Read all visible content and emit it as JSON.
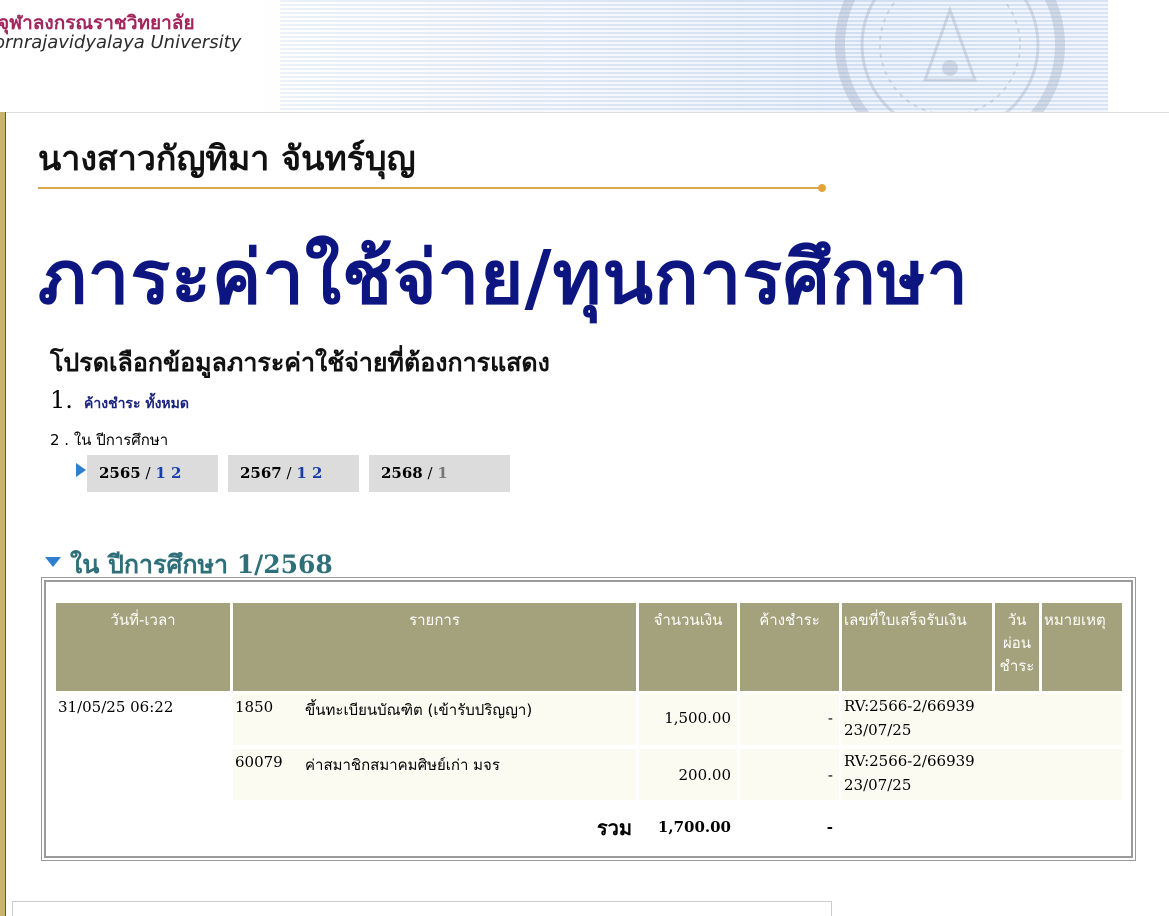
{
  "header": {
    "university_th": "จุฬาลงกรณราชวิทยาลัย",
    "university_en": "ornrajavidyalaya University"
  },
  "student_name": "นางสาวกัญทิมา จันทร์บุญ",
  "page_heading": "ภาระค่าใช้จ่าย/ทุนการศึกษา",
  "prompt": "โปรดเลือกข้อมูลภาระค่าใช้จ่ายที่ต้องการแสดง",
  "options": {
    "opt1_num": "1.",
    "opt1_label": "ค้างชำระ ทั้งหมด",
    "opt2_label": "2 . ใน ปีการศึกษา"
  },
  "years": [
    {
      "year": "2565",
      "sems": [
        "1",
        "2"
      ]
    },
    {
      "year": "2567",
      "sems": [
        "1",
        "2"
      ]
    },
    {
      "year": "2568",
      "sems": [
        "1"
      ]
    }
  ],
  "section": {
    "prefix": "ใน ปีการศึกษา",
    "term": "1/2568"
  },
  "table": {
    "headers": {
      "datetime": "วันที่-เวลา",
      "item": "รายการ",
      "amount": "จำนวนเงิน",
      "outstanding": "ค้างชำระ",
      "receipt": "เลขที่ใบเสร็จรับเงิน",
      "installment": "วัน ผ่อน ชำระ",
      "remark": "หมายเหตุ"
    },
    "rows": [
      {
        "datetime": "31/05/25 06:22",
        "code": "1850",
        "description": "ขึ้นทะเบียนบัณฑิต (เข้ารับปริญญา)",
        "amount": "1,500.00",
        "outstanding": "-",
        "receipt_no": "RV:2566-2/66939",
        "receipt_date": "23/07/25"
      },
      {
        "datetime": "",
        "code": "60079",
        "description": "ค่าสมาชิกสมาคมศิษย์เก่า มจร",
        "amount": "200.00",
        "outstanding": "-",
        "receipt_no": "RV:2566-2/66939",
        "receipt_date": "23/07/25"
      }
    ],
    "total_label": "รวม",
    "total_amount": "1,700.00",
    "total_outstanding": "-"
  },
  "colors": {
    "heading_blue": "#0d1680",
    "section_teal": "#2e6f79",
    "table_header_bg": "#a4a27c",
    "accent_orange": "#e4a23b",
    "university_magenta": "#a0265c"
  }
}
